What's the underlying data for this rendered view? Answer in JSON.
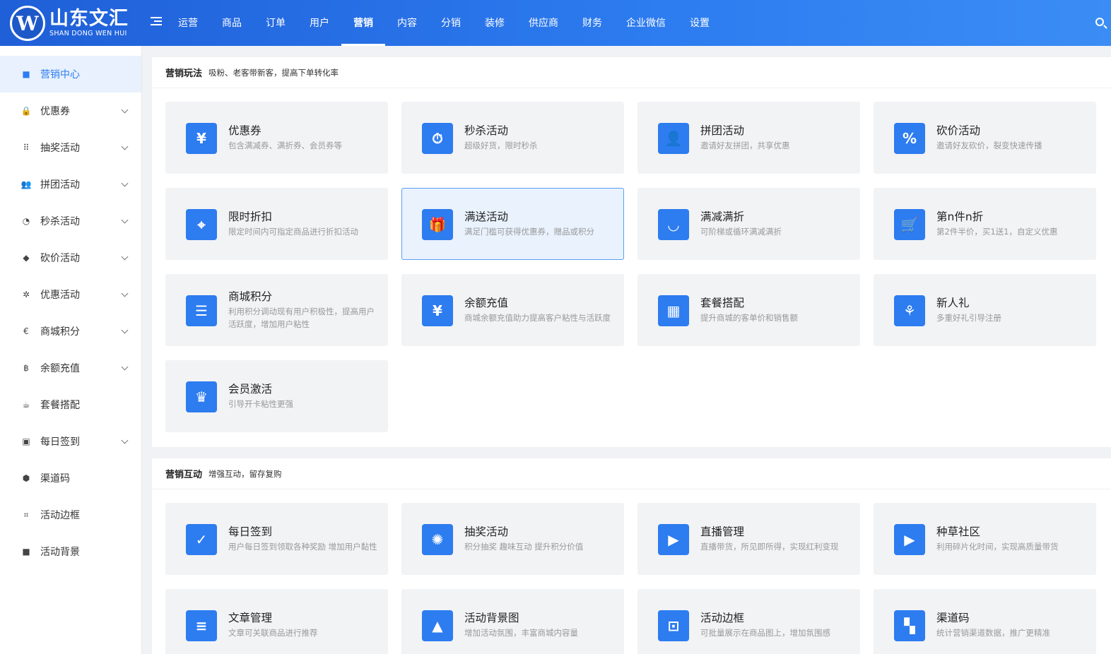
{
  "brand": {
    "name_cn": "山东文汇",
    "name_en": "SHAN DONG WEN HUI",
    "mark": "W"
  },
  "colors": {
    "primary": "#2d7cf0",
    "topbar": "#1f5fd8",
    "card_bg": "#f2f3f5",
    "selected_bg": "#e9f2fd"
  },
  "nav": {
    "items": [
      {
        "label": "运营"
      },
      {
        "label": "商品"
      },
      {
        "label": "订单"
      },
      {
        "label": "用户"
      },
      {
        "label": "营销",
        "active": true
      },
      {
        "label": "内容"
      },
      {
        "label": "分销"
      },
      {
        "label": "装修"
      },
      {
        "label": "供应商"
      },
      {
        "label": "财务"
      },
      {
        "label": "企业微信"
      },
      {
        "label": "设置"
      }
    ]
  },
  "sidebar": {
    "items": [
      {
        "label": "营销中心",
        "icon": "square-icon",
        "glyph": "■",
        "active": true,
        "expandable": false
      },
      {
        "label": "优惠券",
        "icon": "lock-icon",
        "glyph": "🔒",
        "expandable": true
      },
      {
        "label": "抽奖活动",
        "icon": "grid-icon",
        "glyph": "⠿",
        "expandable": true
      },
      {
        "label": "拼团活动",
        "icon": "users-icon",
        "glyph": "👥",
        "expandable": true
      },
      {
        "label": "秒杀活动",
        "icon": "clock-icon",
        "glyph": "◔",
        "expandable": true
      },
      {
        "label": "砍价活动",
        "icon": "tag-icon",
        "glyph": "◆",
        "expandable": true
      },
      {
        "label": "优惠活动",
        "icon": "award-icon",
        "glyph": "✲",
        "expandable": true
      },
      {
        "label": "商城积分",
        "icon": "euro-icon",
        "glyph": "€",
        "expandable": true
      },
      {
        "label": "余额充值",
        "icon": "bitcoin-icon",
        "glyph": "฿",
        "expandable": true
      },
      {
        "label": "套餐搭配",
        "icon": "coffee-icon",
        "glyph": "☕",
        "expandable": false
      },
      {
        "label": "每日签到",
        "icon": "calendar-icon",
        "glyph": "▣",
        "expandable": true
      },
      {
        "label": "渠道码",
        "icon": "cube-icon",
        "glyph": "⬢",
        "expandable": false
      },
      {
        "label": "活动边框",
        "icon": "crop-icon",
        "glyph": "⌗",
        "expandable": false
      },
      {
        "label": "活动背景",
        "icon": "stop-icon",
        "glyph": "■",
        "expandable": false
      }
    ]
  },
  "sections": [
    {
      "title": "营销玩法",
      "subtitle": "吸粉、老客带新客，提高下单转化率",
      "cards": [
        {
          "title": "优惠券",
          "desc": "包含满减券、满折券、会员券等",
          "icon": "coupon-icon",
          "glyph": "¥"
        },
        {
          "title": "秒杀活动",
          "desc": "超级好货，限时秒杀",
          "icon": "flash-clock-icon",
          "glyph": "⏱"
        },
        {
          "title": "拼团活动",
          "desc": "邀请好友拼团，共享优惠",
          "icon": "user-icon",
          "glyph": "👤"
        },
        {
          "title": "砍价活动",
          "desc": "邀请好友砍价，裂变快速传播",
          "icon": "percent-tag-icon",
          "glyph": "%"
        },
        {
          "title": "限时折扣",
          "desc": "限定时间内可指定商品进行折扣活动",
          "icon": "discount-tag-icon",
          "glyph": "⌖"
        },
        {
          "title": "满送活动",
          "desc": "满足门槛可获得优惠券，赠品或积分",
          "icon": "gift-icon",
          "glyph": "🎁",
          "selected": true
        },
        {
          "title": "满减满折",
          "desc": "可阶梯或循环满减满折",
          "icon": "shopping-bag-icon",
          "glyph": "◡"
        },
        {
          "title": "第n件n折",
          "desc": "第2件半价，买1送1，自定义优惠",
          "icon": "cart-icon",
          "glyph": "🛒"
        },
        {
          "title": "商城积分",
          "desc": "利用积分调动现有用户积极性，提高用户活跃度，增加用户粘性",
          "icon": "database-icon",
          "glyph": "☰"
        },
        {
          "title": "余额充值",
          "desc": "商城余额充值助力提高客户粘性与活跃度",
          "icon": "money-bag-icon",
          "glyph": "¥"
        },
        {
          "title": "套餐搭配",
          "desc": "提升商城的客单价和销售额",
          "icon": "apps-icon",
          "glyph": "▦"
        },
        {
          "title": "新人礼",
          "desc": "多重好礼引导注册",
          "icon": "balloon-icon",
          "glyph": "⚘"
        },
        {
          "title": "会员激活",
          "desc": "引导开卡粘性更强",
          "icon": "crown-icon",
          "glyph": "♛"
        }
      ]
    },
    {
      "title": "营销互动",
      "subtitle": "增强互动，留存复购",
      "cards": [
        {
          "title": "每日签到",
          "desc": "用户每日签到领取各种奖励 增加用户黏性",
          "icon": "calendar-check-icon",
          "glyph": "✓"
        },
        {
          "title": "抽奖活动",
          "desc": "积分抽奖 趣味互动 提升积分价值",
          "icon": "wheel-icon",
          "glyph": "✺"
        },
        {
          "title": "直播管理",
          "desc": "直播带货，所见即所得，实现红利变现",
          "icon": "tv-play-icon",
          "glyph": "▶"
        },
        {
          "title": "种草社区",
          "desc": "利用碎片化时间，实现高质量带货",
          "icon": "video-icon",
          "glyph": "▶"
        },
        {
          "title": "文章管理",
          "desc": "文章可关联商品进行推荐",
          "icon": "article-icon",
          "glyph": "≡"
        },
        {
          "title": "活动背景图",
          "desc": "增加活动氛围，丰富商城内容量",
          "icon": "image-icon",
          "glyph": "▲"
        },
        {
          "title": "活动边框",
          "desc": "可批量展示在商品图上，增加氛围感",
          "icon": "frame-icon",
          "glyph": "⊡"
        },
        {
          "title": "渠道码",
          "desc": "统计营销渠道数据，推广更精准",
          "icon": "qrcode-icon",
          "glyph": "▚"
        }
      ]
    }
  ]
}
